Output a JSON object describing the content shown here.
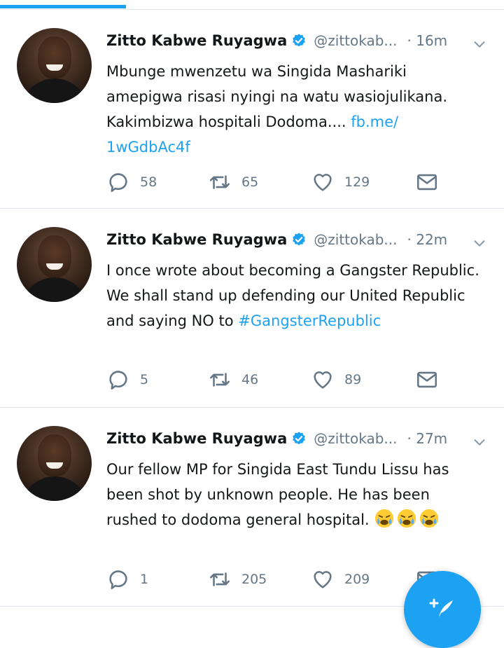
{
  "colors": {
    "accent": "#1da1f2",
    "muted": "#657786",
    "text": "#14171a",
    "divider": "#e1e8ed"
  },
  "tweets": [
    {
      "author": "Zitto Kabwe Ruyagwa",
      "handle": "@zittokab...",
      "time": "· 16m",
      "text": "Mbunge mwenzetu wa Singida Mashariki amepigwa risasi nyingi na watu wasiojulikana. Kakimbizwa hospitali Dodoma....",
      "link": "fb.me/ 1wGdbAc4f",
      "replies": "58",
      "retweets": "65",
      "likes": "129"
    },
    {
      "author": "Zitto Kabwe Ruyagwa",
      "handle": "@zittokab...",
      "time": "· 22m",
      "text": "I once wrote about becoming a Gangster Republic. We shall stand up defending our United Republic and saying NO to",
      "hashtag": "#GangsterRepublic",
      "replies": "5",
      "retweets": "46",
      "likes": "89"
    },
    {
      "author": "Zitto Kabwe Ruyagwa",
      "handle": "@zittokab...",
      "time": "· 27m",
      "text": "Our fellow MP for Singida East Tundu Lissu has been shot by unknown people. He has been rushed to dodoma general hospital.",
      "emojis": [
        "crying-face",
        "crying-face",
        "crying-face"
      ],
      "replies": "1",
      "retweets": "205",
      "likes": "209"
    }
  ],
  "icons": {
    "verified": "verified-badge-icon",
    "reply": "reply-bubble-icon",
    "retweet": "retweet-arrows-icon",
    "like": "heart-icon",
    "dm": "envelope-icon",
    "menu": "chevron-down-icon",
    "compose": "compose-feather-icon"
  }
}
